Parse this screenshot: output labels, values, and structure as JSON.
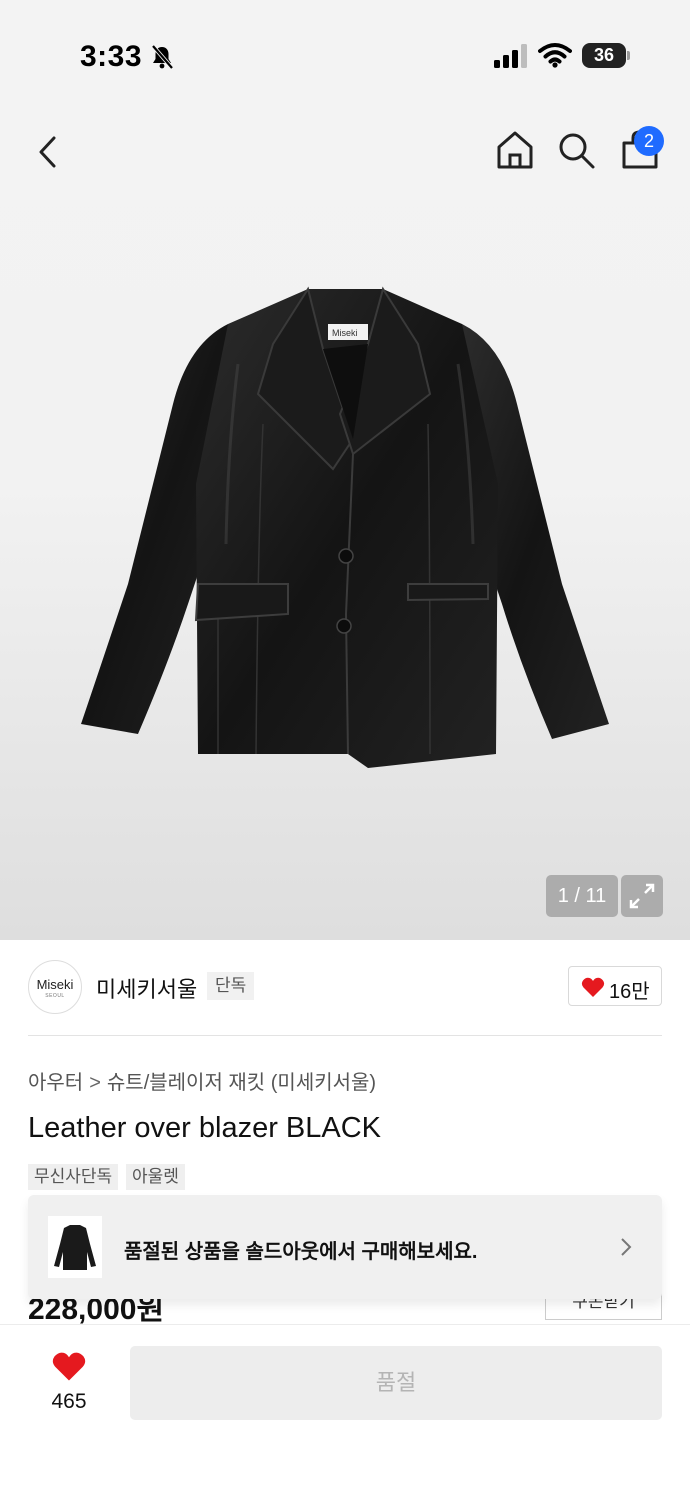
{
  "status_bar": {
    "time": "3:33",
    "battery": "36",
    "icons": [
      "bell-slash-icon",
      "signal-icon",
      "wifi-icon",
      "battery-icon"
    ]
  },
  "nav": {
    "icons": [
      "chevron-left-icon",
      "home-icon",
      "search-icon",
      "shopping-bag-icon"
    ],
    "cart_badge": "2"
  },
  "gallery": {
    "counter": "1 / 11",
    "expand_icon": "expand-icon",
    "logo_label": "Miseki"
  },
  "brand": {
    "logo_main": "Miseki",
    "logo_sub": "SEOUL",
    "name": "미세키서울",
    "tag": "단독",
    "like_count": "16만",
    "like_color": "#e5191f"
  },
  "product": {
    "breadcrumb": [
      "아우터",
      "슈트/블레이저 재킷 (미세키서울)"
    ],
    "breadcrumb_sep": ">",
    "title": "Leather over blazer BLACK",
    "chips": [
      "무신사단독",
      "아울렛"
    ],
    "price": "228,000원",
    "coupon_label": "쿠폰받기"
  },
  "soldout_banner": {
    "text": "품절된 상품을 솔드아웃에서 구매해보세요."
  },
  "bottom_bar": {
    "wish_count": "465",
    "soldout_label": "품절",
    "accent": "#e5191f"
  }
}
